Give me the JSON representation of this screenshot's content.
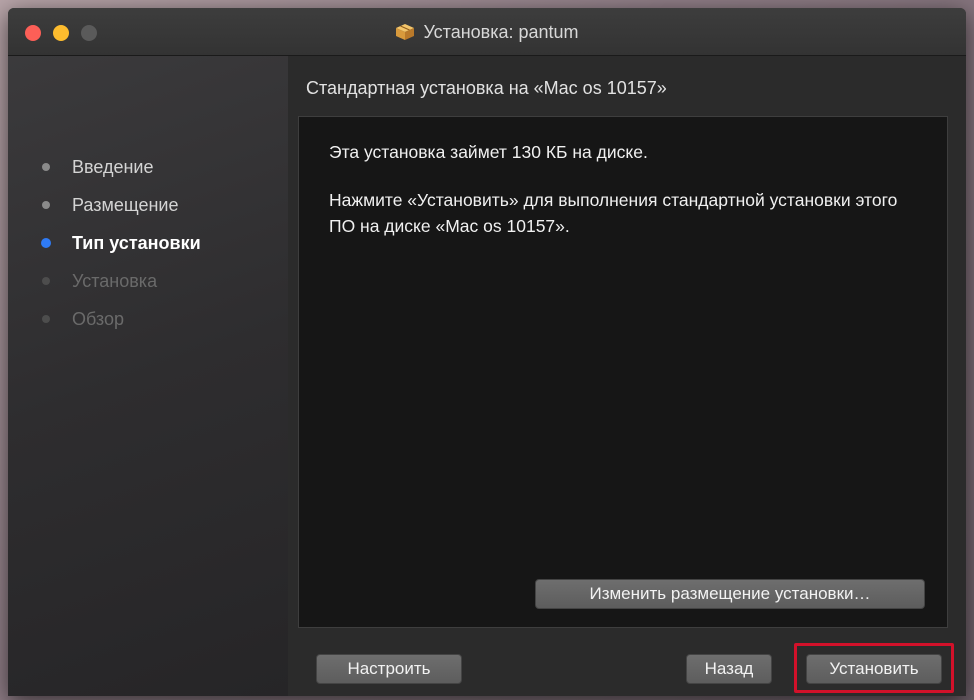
{
  "window": {
    "title": "Установка: pantum"
  },
  "sidebar": {
    "steps": [
      {
        "label": "Введение",
        "state": "done"
      },
      {
        "label": "Размещение",
        "state": "done"
      },
      {
        "label": "Тип установки",
        "state": "active"
      },
      {
        "label": "Установка",
        "state": "pending"
      },
      {
        "label": "Обзор",
        "state": "pending"
      }
    ]
  },
  "main": {
    "heading": "Стандартная установка на «Mac os 10157»",
    "message_size": "Эта установка займет 130 КБ на диске.",
    "message_instructions": "Нажмите «Установить» для выполнения стандартной установки этого ПО на диске «Mac os 10157».",
    "change_location_label": "Изменить размещение установки…"
  },
  "footer": {
    "customize_label": "Настроить",
    "back_label": "Назад",
    "install_label": "Установить"
  },
  "colors": {
    "active_step": "#2f7bf5",
    "highlight": "#d2112a",
    "close": "#fc5f57",
    "minimize": "#fdbc2e"
  },
  "icons": {
    "title": "package-icon"
  }
}
